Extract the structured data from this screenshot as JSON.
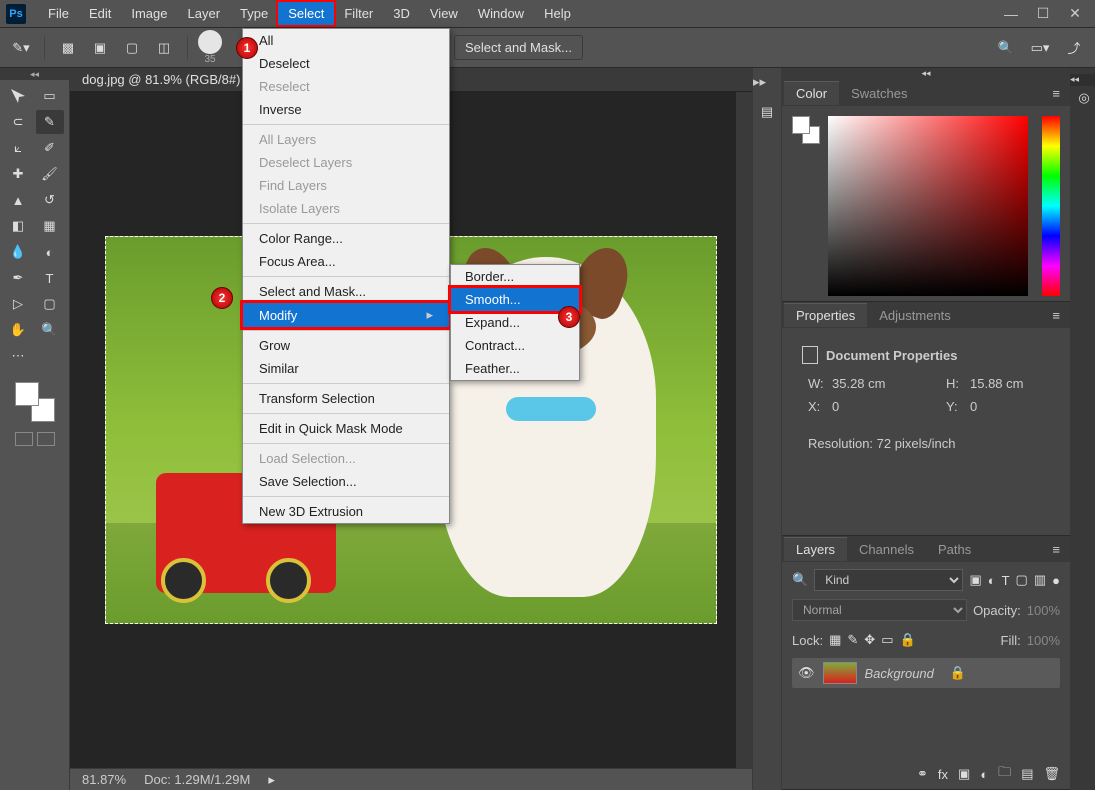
{
  "menubar": {
    "items": [
      "File",
      "Edit",
      "Image",
      "Layer",
      "Type",
      "Select",
      "Filter",
      "3D",
      "View",
      "Window",
      "Help"
    ],
    "highlighted": "Select"
  },
  "optbar": {
    "brush_size": "35",
    "select_mask": "Select and Mask..."
  },
  "doc_tab": "dog.jpg @ 81.9% (RGB/8#)",
  "status": {
    "zoom": "81.87%",
    "doc": "Doc: 1.29M/1.29M"
  },
  "dropdown": {
    "groups": [
      [
        {
          "label": "All"
        },
        {
          "label": "Deselect"
        },
        {
          "label": "Reselect",
          "disabled": true
        },
        {
          "label": "Inverse"
        }
      ],
      [
        {
          "label": "All Layers",
          "disabled": true
        },
        {
          "label": "Deselect Layers",
          "disabled": true
        },
        {
          "label": "Find Layers",
          "disabled": true
        },
        {
          "label": "Isolate Layers",
          "disabled": true
        }
      ],
      [
        {
          "label": "Color Range..."
        },
        {
          "label": "Focus Area..."
        }
      ],
      [
        {
          "label": "Select and Mask..."
        },
        {
          "label": "Modify",
          "arrow": true,
          "selected": true
        }
      ],
      [
        {
          "label": "Grow"
        },
        {
          "label": "Similar"
        }
      ],
      [
        {
          "label": "Transform Selection"
        }
      ],
      [
        {
          "label": "Edit in Quick Mask Mode"
        }
      ],
      [
        {
          "label": "Load Selection...",
          "disabled": true
        },
        {
          "label": "Save Selection..."
        }
      ],
      [
        {
          "label": "New 3D Extrusion"
        }
      ]
    ]
  },
  "submenu": [
    {
      "label": "Border..."
    },
    {
      "label": "Smooth...",
      "selected": true
    },
    {
      "label": "Expand..."
    },
    {
      "label": "Contract..."
    },
    {
      "label": "Feather..."
    }
  ],
  "panels": {
    "color": {
      "tabs": [
        "Color",
        "Swatches"
      ],
      "active": "Color"
    },
    "properties": {
      "tabs": [
        "Properties",
        "Adjustments"
      ],
      "active": "Properties",
      "title": "Document Properties",
      "w_label": "W:",
      "w": "35.28 cm",
      "h_label": "H:",
      "h": "15.88 cm",
      "x_label": "X:",
      "x": "0",
      "y_label": "Y:",
      "y": "0",
      "resolution": "Resolution: 72 pixels/inch"
    },
    "layers": {
      "tabs": [
        "Layers",
        "Channels",
        "Paths"
      ],
      "active": "Layers",
      "kind": "Kind",
      "blend": "Normal",
      "opacity_label": "Opacity:",
      "opacity": "100%",
      "lock": "Lock:",
      "fill_label": "Fill:",
      "fill": "100%",
      "item": {
        "name": "Background",
        "italic": true,
        "locked": true
      }
    }
  },
  "badges": {
    "b1": "1",
    "b2": "2",
    "b3": "3"
  }
}
